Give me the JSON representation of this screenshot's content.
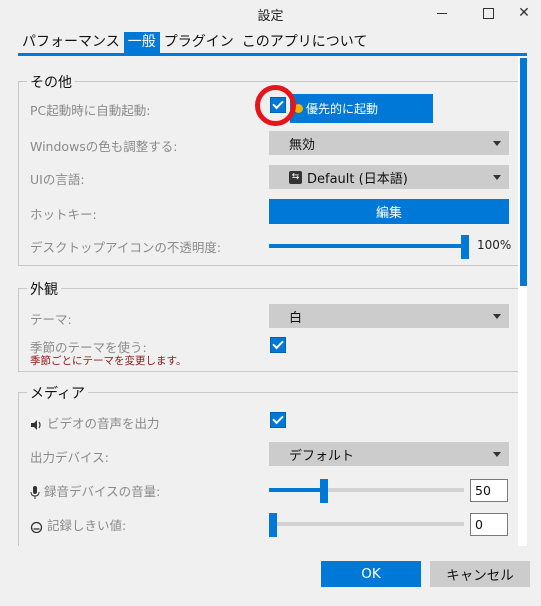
{
  "window": {
    "title": "設定"
  },
  "tabs": [
    {
      "label": "パフォーマンス",
      "active": false
    },
    {
      "label": "一般",
      "active": true
    },
    {
      "label": "プラグイン",
      "active": false
    },
    {
      "label": "このアプリについて",
      "active": false
    }
  ],
  "sections": {
    "other": {
      "legend": "その他",
      "autostart_label": "PC起動時に自動起動:",
      "autostart_checked": true,
      "priority_button": "優先的に起動",
      "windows_color_label": "Windowsの色も調整する:",
      "windows_color_value": "無効",
      "ui_language_label": "UIの言語:",
      "ui_language_value": "Default (日本語)",
      "hotkey_label": "ホットキー:",
      "hotkey_button": "編集",
      "opacity_label": "デスクトップアイコンの不透明度:",
      "opacity_value": 1.0,
      "opacity_text": "100%"
    },
    "appearance": {
      "legend": "外観",
      "theme_label": "テーマ:",
      "theme_value": "白",
      "seasonal_label": "季節のテーマを使う:",
      "seasonal_checked": true,
      "seasonal_note": "季節ごとにテーマを変更します。"
    },
    "media": {
      "legend": "メディア",
      "video_audio_label": "ビデオの音声を出力",
      "video_audio_checked": true,
      "output_device_label": "出力デバイス:",
      "output_device_value": "デフォルト",
      "record_volume_label": "録音デバイスの音量:",
      "record_volume_value": "50",
      "record_volume_fraction": 0.5,
      "threshold_label": "記録しきい値:",
      "threshold_value": "0",
      "threshold_fraction": 0.0
    }
  },
  "footer": {
    "ok_label": "OK",
    "cancel_label": "キャンセル"
  },
  "colors": {
    "accent": "#0078d7",
    "highlight_ring": "#e8141c"
  }
}
